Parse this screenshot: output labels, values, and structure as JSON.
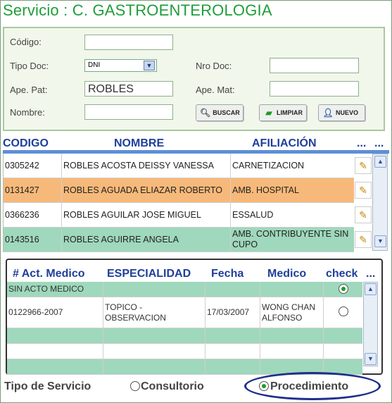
{
  "title": "Servicio : C. GASTROENTEROLOGIA",
  "search": {
    "codigo_label": "Código:",
    "codigo_value": "",
    "tipo_doc_label": "Tipo Doc:",
    "tipo_doc_value": "DNI",
    "nro_doc_label": "Nro Doc:",
    "nro_doc_value": "",
    "ape_pat_label": "Ape. Pat:",
    "ape_pat_value": "ROBLES",
    "ape_mat_label": "Ape. Mat:",
    "ape_mat_value": "",
    "nombre_label": "Nombre:",
    "nombre_value": "",
    "buscar_label": "BUSCAR",
    "limpiar_label": "LIMPIAR",
    "nuevo_label": "NUEVO"
  },
  "patients": {
    "headers": [
      "CODIGO",
      "NOMBRE",
      "AFILIACIÓN",
      "...",
      "..."
    ],
    "rows": [
      {
        "codigo": "0305242",
        "nombre": "ROBLES ACOSTA DEISSY VANESSA",
        "afiliacion": "CARNETIZACION",
        "bg": "#ffffff"
      },
      {
        "codigo": "0131427",
        "nombre": "ROBLES AGUADA ELIAZAR ROBERTO",
        "afiliacion": "AMB. HOSPITAL",
        "bg": "#f7b97a"
      },
      {
        "codigo": "0366236",
        "nombre": "ROBLES AGUILAR JOSE MIGUEL",
        "afiliacion": "ESSALUD",
        "bg": "#ffffff"
      },
      {
        "codigo": "0143516",
        "nombre": "ROBLES AGUIRRE ANGELA",
        "afiliacion": "AMB. CONTRIBUYENTE SIN CUPO",
        "bg": "#9fd8bc"
      }
    ]
  },
  "acts": {
    "headers": [
      "# Act. Medico",
      "ESPECIALIDAD",
      "Fecha",
      "Medico",
      "check",
      "..."
    ],
    "rows": [
      {
        "act": "SIN ACTO MEDICO",
        "especialidad": "",
        "fecha": "",
        "medico": "",
        "checked": true,
        "bg": "#9fd8bc"
      },
      {
        "act": "0122966-2007",
        "especialidad": "TOPICO - OBSERVACION",
        "fecha": "17/03/2007",
        "medico": "WONG CHAN ALFONSO",
        "checked": false,
        "bg": "#ffffff"
      },
      {
        "act": "",
        "especialidad": "",
        "fecha": "",
        "medico": "",
        "checked": false,
        "bg": "#9fd8bc"
      },
      {
        "act": "",
        "especialidad": "",
        "fecha": "",
        "medico": "",
        "checked": false,
        "bg": "#ffffff"
      },
      {
        "act": "",
        "especialidad": "",
        "fecha": "",
        "medico": "",
        "checked": false,
        "bg": "#9fd8bc"
      }
    ]
  },
  "footer": {
    "label": "Tipo de Servicio",
    "opt1": "Consultorio",
    "opt2": "Procedimiento",
    "selected": "Procedimiento"
  },
  "icons": {
    "edit": "pencil-icon",
    "buscar": "search-icon",
    "limpiar": "eraser-icon",
    "nuevo": "add-user-icon"
  }
}
